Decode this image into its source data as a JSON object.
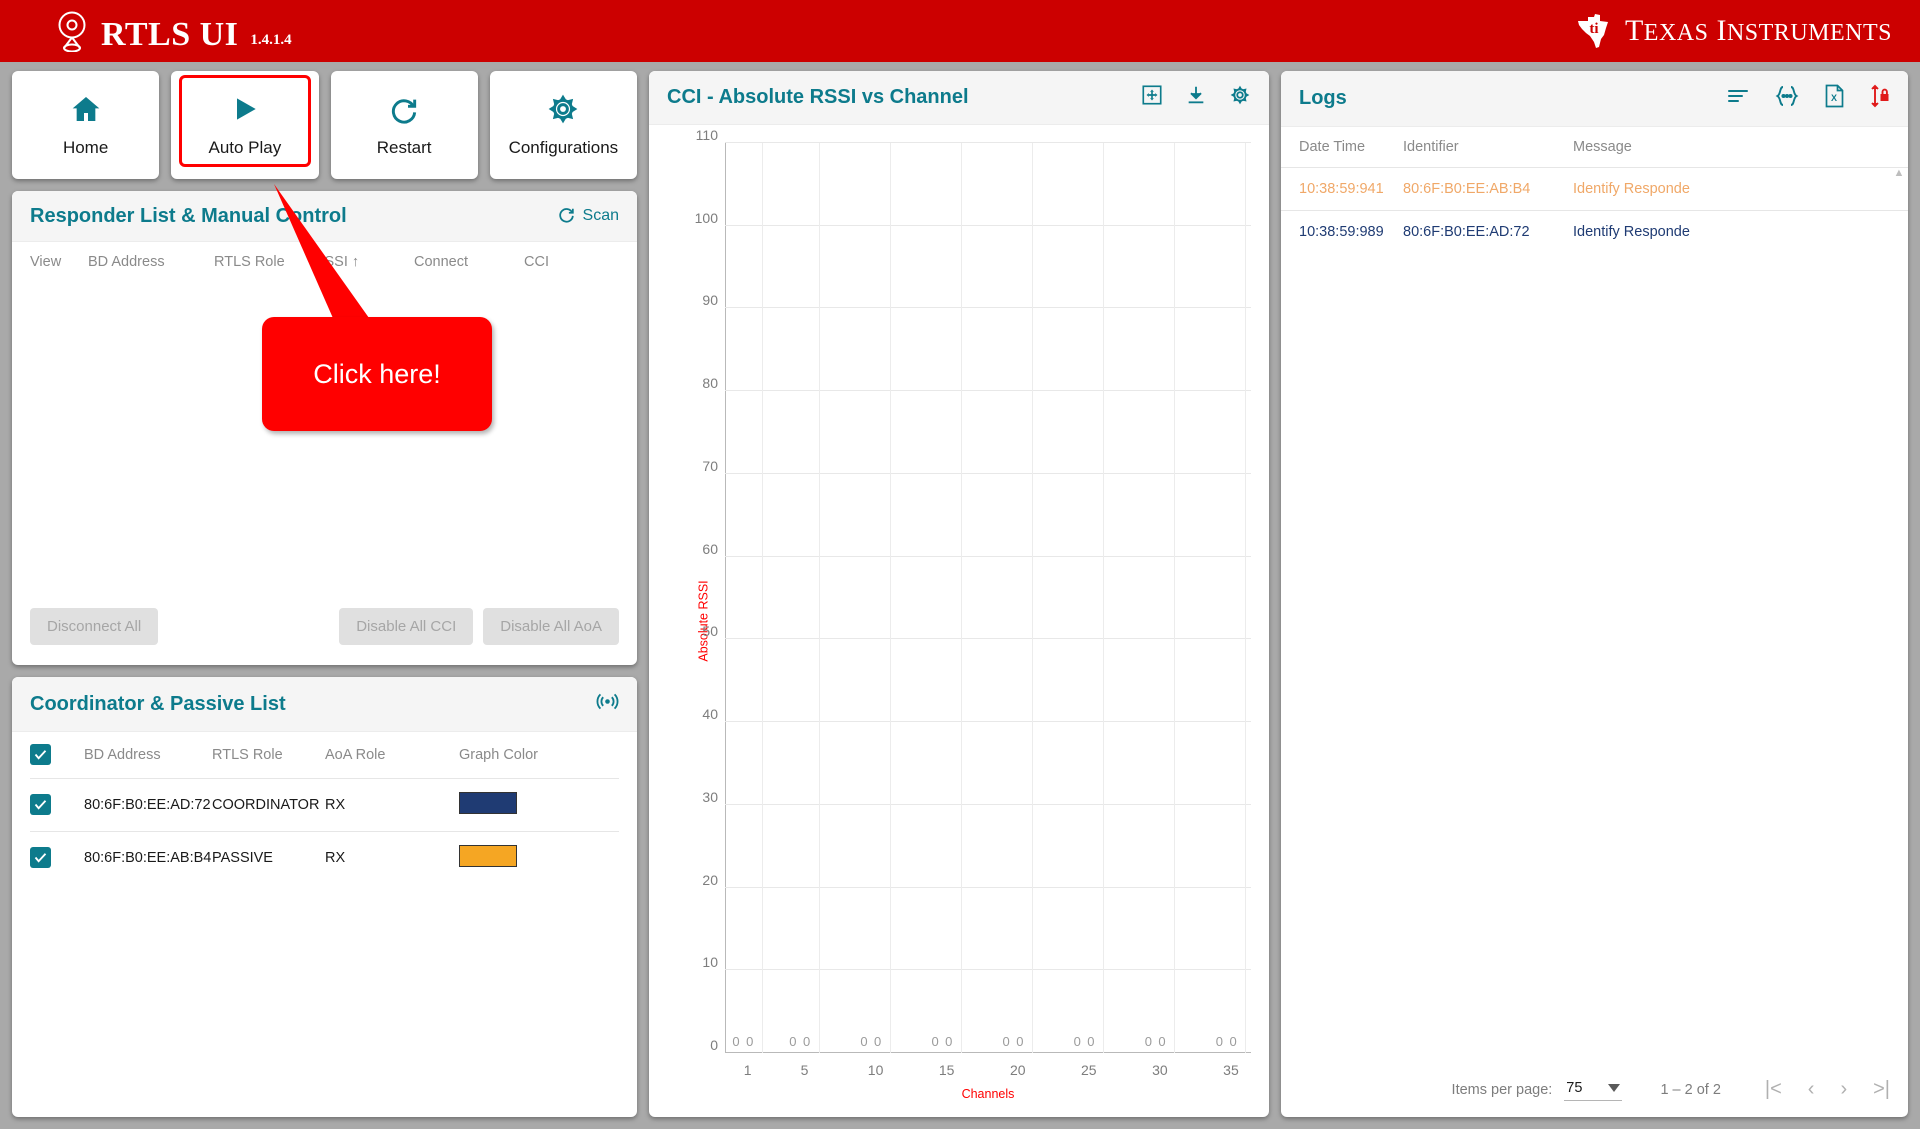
{
  "header": {
    "app_title": "RTLS UI",
    "version": "1.4.1.4",
    "pin_icon": "location-pin-icon",
    "vendor_name_1": "T",
    "vendor_name_1b": "EXAS",
    "vendor_name_2": "I",
    "vendor_name_2b": "NSTRUMENTS",
    "brand_red": "#cc0000"
  },
  "nav": {
    "buttons": [
      {
        "label": "Home",
        "icon": "home-icon",
        "highlighted": false
      },
      {
        "label": "Auto Play",
        "icon": "play-icon",
        "highlighted": true
      },
      {
        "label": "Restart",
        "icon": "restart-icon",
        "highlighted": false
      },
      {
        "label": "Configurations",
        "icon": "gear-icon",
        "highlighted": false
      }
    ]
  },
  "callout": {
    "text": "Click here!",
    "color": "#ff0000"
  },
  "responder": {
    "title": "Responder List & Manual Control",
    "scan_label": "Scan",
    "scan_icon": "refresh-icon",
    "columns": [
      "View",
      "BD Address",
      "RTLS Role",
      "RSSI",
      "Connect",
      "CCI"
    ],
    "sort_indicator": "↑",
    "rows": [],
    "actions": [
      {
        "label": "Disconnect All",
        "disabled": true
      },
      {
        "label": "Disable All CCI",
        "disabled": true
      },
      {
        "label": "Disable All AoA",
        "disabled": true
      }
    ]
  },
  "coordinator": {
    "title": "Coordinator & Passive List",
    "header_icon": "aoa-icon",
    "columns": [
      "BD Address",
      "RTLS Role",
      "AoA Role",
      "Graph Color"
    ],
    "select_all_checked": true,
    "rows": [
      {
        "checked": true,
        "bd_address": "80:6F:B0:EE:AD:72",
        "rtls_role": "COORDINATOR",
        "aoa_role": "RX",
        "graph_color": "#1f3b73"
      },
      {
        "checked": true,
        "bd_address": "80:6F:B0:EE:AB:B4",
        "rtls_role": "PASSIVE",
        "aoa_role": "RX",
        "graph_color": "#f5a košice"
      }
    ]
  },
  "chart_panel": {
    "title": "CCI - Absolute RSSI vs Channel",
    "icons": [
      "fit-screen-icon",
      "download-icon",
      "gear-icon"
    ]
  },
  "chart_data": {
    "type": "bar",
    "title": "CCI - Absolute RSSI vs Channel",
    "xlabel": "Channels",
    "ylabel": "Absolute RSSI",
    "ylim": [
      0,
      110
    ],
    "yticks": [
      0,
      10,
      20,
      30,
      40,
      50,
      60,
      70,
      80,
      90,
      100,
      110
    ],
    "xticks": [
      1,
      5,
      10,
      15,
      20,
      25,
      30,
      35
    ],
    "grid": true,
    "legend": false,
    "series": [
      {
        "name": "80:6F:B0:EE:AD:72",
        "color": "#1f3b73",
        "values": [
          0,
          0,
          0,
          0,
          0,
          0,
          0,
          0
        ]
      },
      {
        "name": "80:6F:B0:EE:AB:B4",
        "color": "#f5a köz",
        "values": [
          0,
          0,
          0,
          0,
          0,
          0,
          0,
          0
        ]
      }
    ],
    "data_labels": [
      "0",
      "0",
      "0",
      "0",
      "0",
      "0",
      "0",
      "0",
      "0",
      "0",
      "0",
      "0",
      "0",
      "0",
      "0",
      "0"
    ]
  },
  "logs": {
    "title": "Logs",
    "icons": [
      "filter-lines-icon",
      "json-icon",
      "excel-icon",
      "autoscroll-lock-icon"
    ],
    "columns": [
      "Date Time",
      "Identifier",
      "Message"
    ],
    "rows": [
      {
        "datetime": "10:38:59:941",
        "identifier": "80:6F:B0:EE:AB:B4",
        "message": "Identify Responde",
        "color": "#f0a868"
      },
      {
        "datetime": "10:38:59:989",
        "identifier": "80:6F:B0:EE:AD:72",
        "message": "Identify Responde",
        "color": "#1f3b73"
      }
    ],
    "paginator": {
      "items_per_page_label": "Items per page:",
      "items_per_page_value": "75",
      "range_label": "1 – 2 of 2",
      "first_icon": "|<",
      "prev_icon": "‹",
      "next_icon": "›",
      "last_icon": ">|"
    }
  }
}
